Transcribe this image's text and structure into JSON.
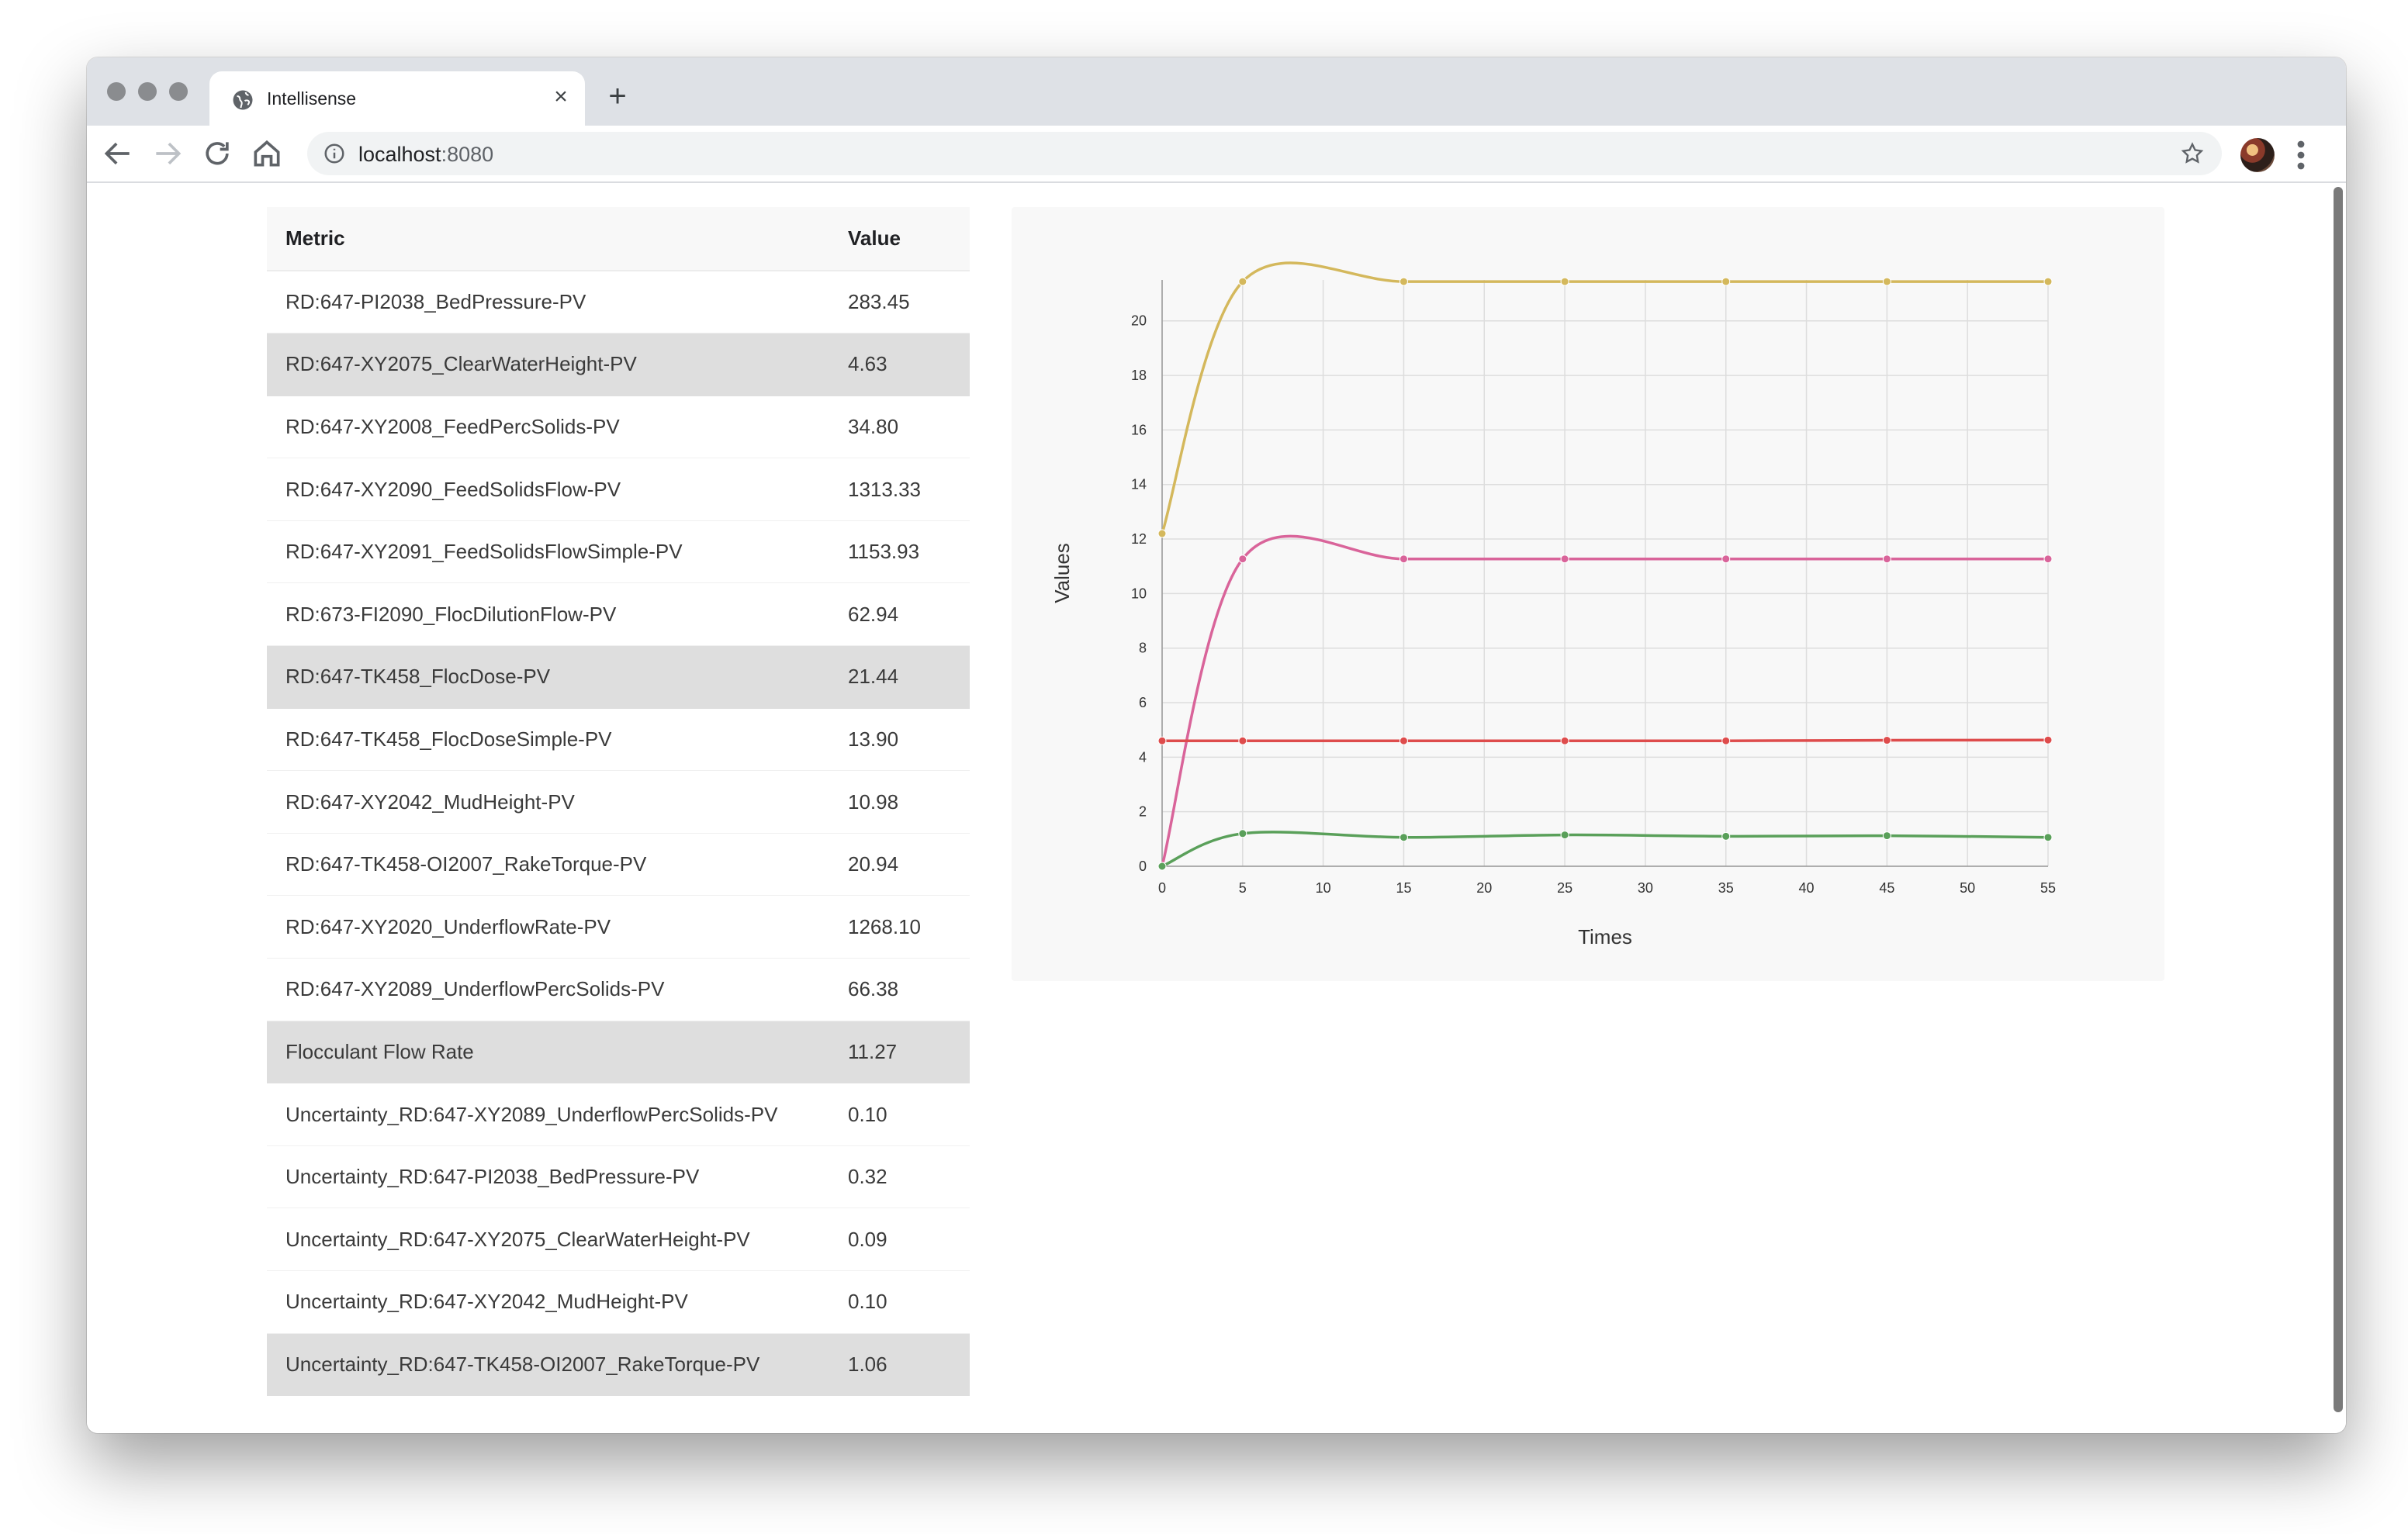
{
  "browser": {
    "tab_title": "Intellisense",
    "url_host": "localhost",
    "url_port": ":8080"
  },
  "table": {
    "headers": [
      "Metric",
      "Value"
    ],
    "rows": [
      {
        "metric": "RD:647-PI2038_BedPressure-PV",
        "value": "283.45",
        "highlighted": false
      },
      {
        "metric": "RD:647-XY2075_ClearWaterHeight-PV",
        "value": "4.63",
        "highlighted": true
      },
      {
        "metric": "RD:647-XY2008_FeedPercSolids-PV",
        "value": "34.80",
        "highlighted": false
      },
      {
        "metric": "RD:647-XY2090_FeedSolidsFlow-PV",
        "value": "1313.33",
        "highlighted": false
      },
      {
        "metric": "RD:647-XY2091_FeedSolidsFlowSimple-PV",
        "value": "1153.93",
        "highlighted": false
      },
      {
        "metric": "RD:673-FI2090_FlocDilutionFlow-PV",
        "value": "62.94",
        "highlighted": false
      },
      {
        "metric": "RD:647-TK458_FlocDose-PV",
        "value": "21.44",
        "highlighted": true
      },
      {
        "metric": "RD:647-TK458_FlocDoseSimple-PV",
        "value": "13.90",
        "highlighted": false
      },
      {
        "metric": "RD:647-XY2042_MudHeight-PV",
        "value": "10.98",
        "highlighted": false
      },
      {
        "metric": "RD:647-TK458-OI2007_RakeTorque-PV",
        "value": "20.94",
        "highlighted": false
      },
      {
        "metric": "RD:647-XY2020_UnderflowRate-PV",
        "value": "1268.10",
        "highlighted": false
      },
      {
        "metric": "RD:647-XY2089_UnderflowPercSolids-PV",
        "value": "66.38",
        "highlighted": false
      },
      {
        "metric": "Flocculant Flow Rate",
        "value": "11.27",
        "highlighted": true
      },
      {
        "metric": "Uncertainty_RD:647-XY2089_UnderflowPercSolids-PV",
        "value": "0.10",
        "highlighted": false
      },
      {
        "metric": "Uncertainty_RD:647-PI2038_BedPressure-PV",
        "value": "0.32",
        "highlighted": false
      },
      {
        "metric": "Uncertainty_RD:647-XY2075_ClearWaterHeight-PV",
        "value": "0.09",
        "highlighted": false
      },
      {
        "metric": "Uncertainty_RD:647-XY2042_MudHeight-PV",
        "value": "0.10",
        "highlighted": false
      },
      {
        "metric": "Uncertainty_RD:647-TK458-OI2007_RakeTorque-PV",
        "value": "1.06",
        "highlighted": true
      }
    ]
  },
  "chart_data": {
    "type": "line",
    "title": "",
    "xlabel": "Times",
    "ylabel": "Values",
    "x": [
      0,
      5,
      15,
      25,
      35,
      45,
      55
    ],
    "xlim": [
      0,
      55
    ],
    "ylim": [
      0,
      21.5
    ],
    "xticks": [
      0,
      5,
      10,
      15,
      20,
      25,
      30,
      35,
      40,
      45,
      50,
      55
    ],
    "yticks": [
      0,
      2,
      4,
      6,
      8,
      10,
      12,
      14,
      16,
      18,
      20
    ],
    "grid": true,
    "series": [
      {
        "color": "#d4b85c",
        "values": [
          12.2,
          21.44,
          21.44,
          21.44,
          21.44,
          21.44,
          21.44
        ]
      },
      {
        "color": "#d9649a",
        "values": [
          0,
          11.27,
          11.27,
          11.27,
          11.27,
          11.27,
          11.27
        ]
      },
      {
        "color": "#de4c4c",
        "values": [
          4.6,
          4.6,
          4.6,
          4.6,
          4.6,
          4.62,
          4.63
        ]
      },
      {
        "color": "#5aa05a",
        "values": [
          0,
          1.2,
          1.06,
          1.15,
          1.1,
          1.12,
          1.06
        ]
      }
    ]
  }
}
